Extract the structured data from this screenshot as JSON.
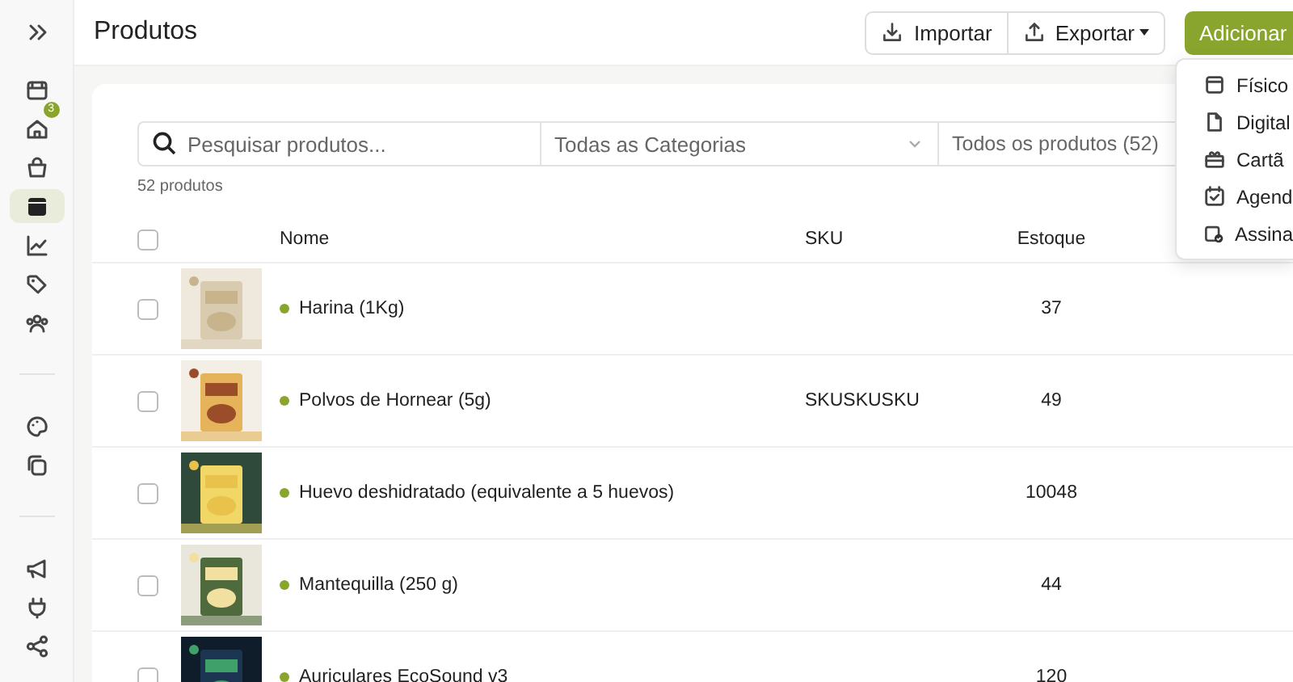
{
  "sidebar": {
    "items": [
      {
        "kind": "button",
        "selected": false
      },
      {
        "kind": "button",
        "selected": false
      },
      {
        "kind": "button",
        "selected": false,
        "badge": "3"
      },
      {
        "kind": "button",
        "selected": false
      },
      {
        "kind": "button",
        "selected": true
      },
      {
        "kind": "button",
        "selected": false
      },
      {
        "kind": "button",
        "selected": false
      },
      {
        "kind": "button",
        "selected": false
      },
      {
        "kind": "divider"
      },
      {
        "kind": "button",
        "selected": false
      },
      {
        "kind": "button",
        "selected": false
      },
      {
        "kind": "divider"
      },
      {
        "kind": "button",
        "selected": false
      },
      {
        "kind": "button",
        "selected": false
      },
      {
        "kind": "button",
        "selected": false
      }
    ]
  },
  "header": {
    "title": "Produtos",
    "import_button": "Importar",
    "export_button": "Exportar",
    "add_button": "Adicionar"
  },
  "add_menu": {
    "items": [
      {
        "label": "Físico"
      },
      {
        "label": "Digital"
      },
      {
        "label": "Cartã"
      },
      {
        "label": "Agend"
      },
      {
        "label": "Assina"
      }
    ]
  },
  "filters": {
    "search": {
      "placeholder": "Pesquisar produtos..."
    },
    "category": "Todas as Categorias",
    "scope": "Todos os produtos (52)"
  },
  "count": "52 produtos",
  "table": {
    "select_all_checked": false,
    "columns": [
      "Nome",
      "SKU",
      "Estoque"
    ],
    "rows": [
      {
        "checked": false,
        "active": true,
        "name": "Harina (1Kg)",
        "stock": "37"
      },
      {
        "checked": false,
        "active": true,
        "name": "Polvos de Hornear (5g)",
        "sku": "SKUSKUSKU",
        "stock": "49"
      },
      {
        "checked": false,
        "active": true,
        "name": "Huevo deshidratado (equivalente a 5 huevos)",
        "stock": "10048"
      },
      {
        "checked": false,
        "active": true,
        "name": "Mantequilla (250 g)",
        "stock": "44"
      },
      {
        "checked": false,
        "active": true,
        "name": "Auriculares EcoSound v3",
        "stock": "120"
      }
    ]
  }
}
